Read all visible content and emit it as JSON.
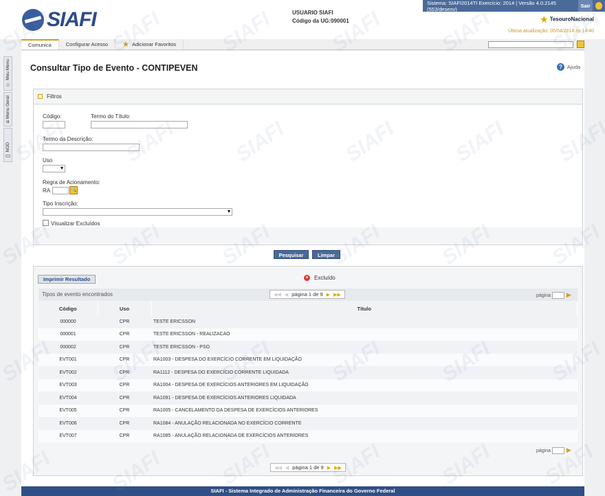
{
  "header": {
    "logo_text": "SIAFI",
    "user_label": "USUARIO SIAFI",
    "ug_label": "Código da UG:",
    "ug_value": "090001",
    "system_info": "Sistema: SIAFI2014TI Exercício: 2014 | Versão 4.0.2145 (553/desenv)",
    "exit_label": "Sair",
    "tesouro_label": "TesouroNacional",
    "last_update": "Última atualização: 05/04/2014 às 14:40"
  },
  "nav": {
    "items": [
      "Comunica",
      "Configurar Acesso"
    ],
    "favorites_label": "Adicionar Favoritos"
  },
  "sidetabs": [
    "Meu Menu",
    "Menu Geral",
    "NOD"
  ],
  "page": {
    "title": "Consultar Tipo de Evento - CONTIPEVEN",
    "help_label": "Ajuda"
  },
  "filters": {
    "section_label": "Filtros",
    "codigo_label": "Código:",
    "termo_titulo_label": "Termo do Título:",
    "termo_descricao_label": "Termo da Descrição:",
    "uso_label": "Uso",
    "regra_label": "Regra de Acionamento:",
    "ra_prefix": "RA",
    "tipo_inscricao_label": "Tipo Inscrição:",
    "visualizar_excluidos_label": "Visualizar Excluídos"
  },
  "actions": {
    "search_label": "Pesquisar",
    "clear_label": "Limpar"
  },
  "results": {
    "print_label": "Imprimir Resultado",
    "excluded_legend": "Excluído",
    "caption": "Tipos de evento encontrados",
    "pager_text": "página 1 de 9",
    "page_label": "página",
    "columns": [
      "Código",
      "Uso",
      "Título"
    ],
    "rows": [
      {
        "codigo": "000000",
        "uso": "CPR",
        "titulo": "TESTE ERICSSON"
      },
      {
        "codigo": "000001",
        "uso": "CPR",
        "titulo": "TESTE ERICSSON - REALIZACAO"
      },
      {
        "codigo": "000002",
        "uso": "CPR",
        "titulo": "TESTE ERICSSON - PSO"
      },
      {
        "codigo": "EVT001",
        "uso": "CPR",
        "titulo": "RA1003 - DESPESA DO EXERCÍCIO CORRENTE EM LIQUIDAÇÃO"
      },
      {
        "codigo": "EVT002",
        "uso": "CPR",
        "titulo": "RA1112 - DESPESA DO EXERCÍCIO CORRENTE LIQUIDADA"
      },
      {
        "codigo": "EVT003",
        "uso": "CPR",
        "titulo": "RA1004 - DESPESA DE EXERCÍCIOS ANTERIORES EM LIQUIDAÇÃO"
      },
      {
        "codigo": "EVT004",
        "uso": "CPR",
        "titulo": "RA1091 - DESPESA DE EXERCÍCIOS ANTERIORES LIQUIDADA"
      },
      {
        "codigo": "EVT005",
        "uso": "CPR",
        "titulo": "RA1005 - CANCELAMENTO DA DESPESA DE EXERCÍCIOS ANTERIORES"
      },
      {
        "codigo": "EVT006",
        "uso": "CPR",
        "titulo": "RA1084 - ANULAÇÃO RELACIONADA NO EXERCÍCIO CORRENTE"
      },
      {
        "codigo": "EVT007",
        "uso": "CPR",
        "titulo": "RA1085 - ANULAÇÃO RELACIONADA DE EXERCÍCIOS ANTERIORES"
      }
    ]
  },
  "footer": {
    "text": "SIAFI - Sistema Integrado de Administração Financeira do Governo Federal"
  },
  "colors": {
    "brand_blue": "#2f4f86",
    "accent_yellow": "#f4c430",
    "excluded_red": "#d9372e"
  }
}
